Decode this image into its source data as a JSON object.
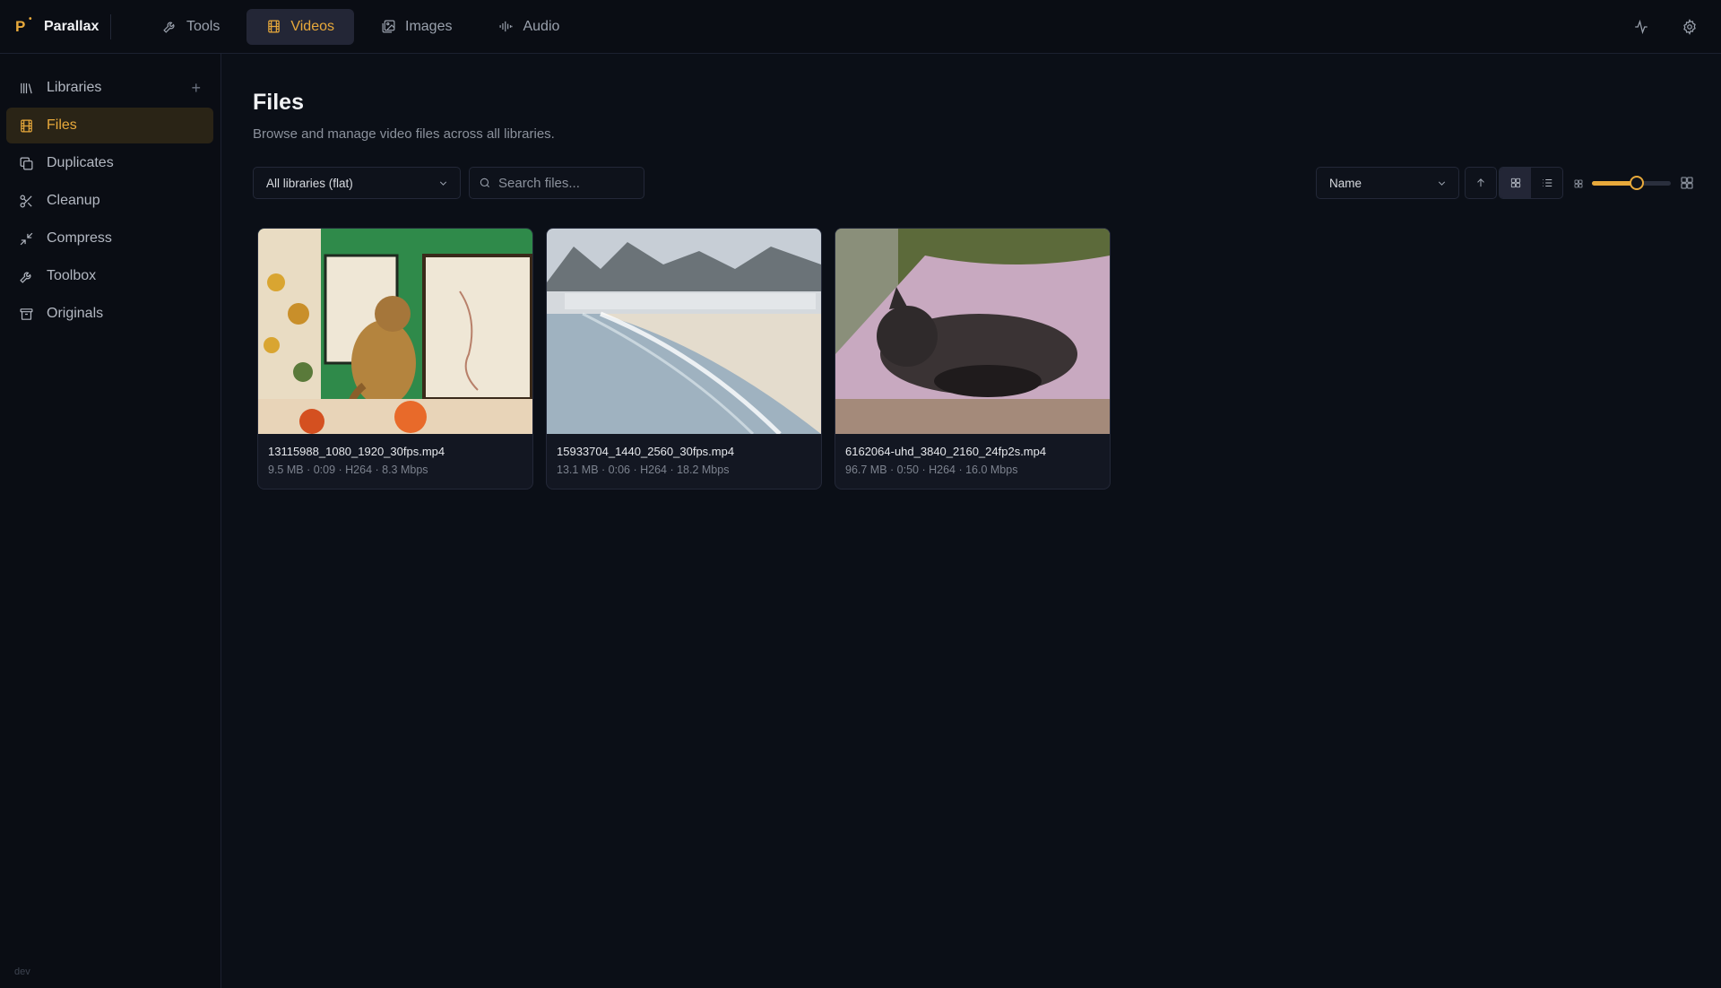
{
  "app": {
    "logo_letter": "P",
    "name": "Parallax",
    "env": "dev"
  },
  "nav": {
    "tabs": [
      {
        "label": "Tools",
        "icon": "wrench-icon"
      },
      {
        "label": "Videos",
        "icon": "film-icon",
        "active": true
      },
      {
        "label": "Images",
        "icon": "image-icon"
      },
      {
        "label": "Audio",
        "icon": "waveform-icon"
      }
    ],
    "right_icons": [
      "activity-icon",
      "gear-icon"
    ]
  },
  "sidebar": {
    "items": [
      {
        "label": "Libraries",
        "icon": "libraries-icon",
        "has_add": true,
        "add_label": "+"
      },
      {
        "label": "Files",
        "icon": "film-icon",
        "active": true
      },
      {
        "label": "Duplicates",
        "icon": "copy-icon"
      },
      {
        "label": "Cleanup",
        "icon": "scissors-icon"
      },
      {
        "label": "Compress",
        "icon": "compress-icon"
      },
      {
        "label": "Toolbox",
        "icon": "wrench-icon"
      },
      {
        "label": "Originals",
        "icon": "archive-icon"
      }
    ]
  },
  "page": {
    "title": "Files",
    "subtitle": "Browse and manage video files across all libraries."
  },
  "toolbar": {
    "library_filter": "All libraries (flat)",
    "search_placeholder": "Search files...",
    "sort_by": "Name",
    "view_mode": "grid",
    "thumbnail_size_fraction": 0.57
  },
  "colors": {
    "accent": "#e8a93b",
    "background": "#0b0f17",
    "panel": "#0a0d14"
  },
  "files": [
    {
      "name": "13115988_1080_1920_30fps.mp4",
      "meta": "9.5 MB · 0:09 · H264 · 8.3 Mbps"
    },
    {
      "name": "15933704_1440_2560_30fps.mp4",
      "meta": "13.1 MB · 0:06 · H264 · 18.2 Mbps"
    },
    {
      "name": "6162064-uhd_3840_2160_24fp2s.mp4",
      "meta": "96.7 MB · 0:50 · H264 · 16.0 Mbps"
    }
  ]
}
